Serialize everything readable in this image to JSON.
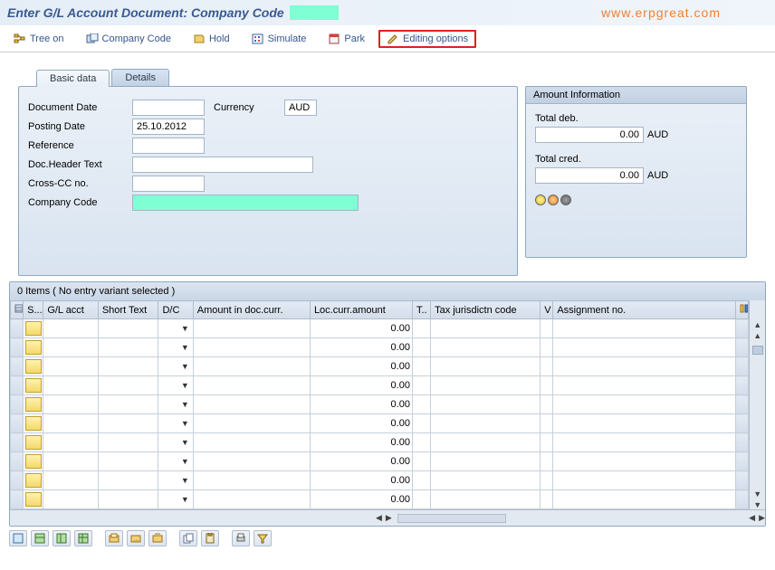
{
  "title_main": "Enter G/L Account Document: Company Code",
  "watermark": "www.erpgreat.com",
  "toolbar": {
    "tree_on": "Tree on",
    "company_code": "Company Code",
    "hold": "Hold",
    "simulate": "Simulate",
    "park": "Park",
    "editing_options": "Editing options"
  },
  "tabs": {
    "basic_data": "Basic data",
    "details": "Details"
  },
  "form": {
    "document_date_lbl": "Document Date",
    "document_date_val": "",
    "currency_lbl": "Currency",
    "currency_val": "AUD",
    "posting_date_lbl": "Posting Date",
    "posting_date_val": "25.10.2012",
    "reference_lbl": "Reference",
    "reference_val": "",
    "doc_header_lbl": "Doc.Header Text",
    "doc_header_val": "",
    "cross_cc_lbl": "Cross-CC no.",
    "cross_cc_val": "",
    "company_code_lbl": "Company Code",
    "company_code_val": ""
  },
  "amount_info": {
    "title": "Amount Information",
    "total_deb_lbl": "Total deb.",
    "total_deb_val": "0.00",
    "total_cred_lbl": "Total cred.",
    "total_cred_val": "0.00",
    "currency": "AUD"
  },
  "items_header": "0 Items ( No entry variant selected )",
  "columns": {
    "status": "S...",
    "gl_acct": "G/L acct",
    "short_text": "Short Text",
    "dc": "D/C",
    "amount_doc": "Amount in doc.curr.",
    "loc_amount": "Loc.curr.amount",
    "tax": "T..",
    "tax_jur": "Tax jurisdictn code",
    "v": "V",
    "assignment": "Assignment no."
  },
  "row_loc_amount": "0.00"
}
